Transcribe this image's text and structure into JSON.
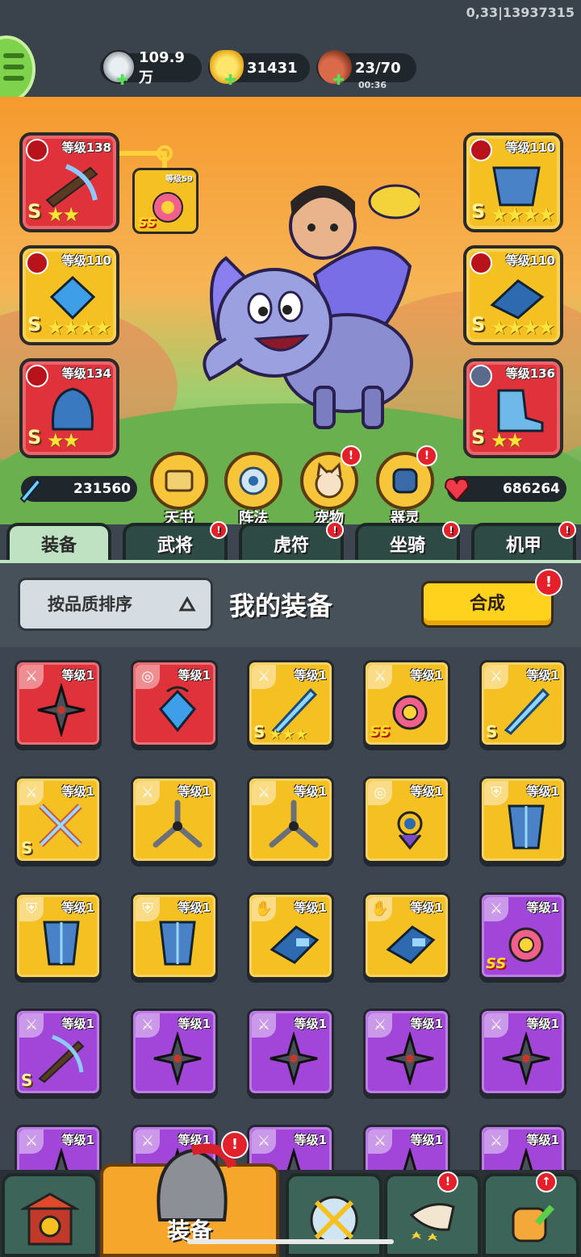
{
  "build_info": "0,33|13937315",
  "resources": {
    "silver": {
      "value": "109.9万",
      "icon": "silver-coin-icon"
    },
    "gold": {
      "value": "31431",
      "icon": "gold-ingot-icon"
    },
    "stamina": {
      "value": "23/70",
      "timer": "00:36",
      "icon": "meat-leg-icon"
    }
  },
  "hero": {
    "equipped_left": [
      {
        "level": "等级138",
        "grade": "S",
        "stars": "★★",
        "color": "red"
      },
      {
        "level": "等级110",
        "grade": "S",
        "stars": "★★★★",
        "color": "gold"
      },
      {
        "level": "等级134",
        "grade": "S",
        "stars": "★★",
        "color": "red"
      }
    ],
    "equipped_right": [
      {
        "level": "等级110",
        "grade": "S",
        "stars": "★★★★",
        "color": "gold"
      },
      {
        "level": "等级110",
        "grade": "S",
        "stars": "★★★★",
        "color": "gold"
      },
      {
        "level": "等级136",
        "grade": "S",
        "stars": "★★",
        "color": "red"
      }
    ],
    "linked_item": {
      "level": "等级59",
      "grade": "SS"
    },
    "attack": "231560",
    "hp": "686264"
  },
  "features": [
    {
      "label": "天书",
      "icon": "scroll-book-icon",
      "badge": false
    },
    {
      "label": "阵法",
      "icon": "formation-icon",
      "badge": false
    },
    {
      "label": "宠物",
      "icon": "pet-cat-icon",
      "badge": true
    },
    {
      "label": "器灵",
      "icon": "artifact-spirit-icon",
      "badge": true
    }
  ],
  "tabs": [
    {
      "label": "装备",
      "active": true,
      "badge": false
    },
    {
      "label": "武将",
      "active": false,
      "badge": true
    },
    {
      "label": "虎符",
      "active": false,
      "badge": true
    },
    {
      "label": "坐骑",
      "active": false,
      "badge": true
    },
    {
      "label": "机甲",
      "active": false,
      "badge": true
    }
  ],
  "panel": {
    "sort_label": "按品质排序",
    "title": "我的装备",
    "merge_label": "合成",
    "badge": "!"
  },
  "inventory": [
    {
      "level": "等级1",
      "color": "red",
      "tag": "sword",
      "art": "shuriken"
    },
    {
      "level": "等级1",
      "color": "red",
      "tag": "medal",
      "art": "amulet"
    },
    {
      "level": "等级1",
      "color": "gold",
      "tag": "sword",
      "art": "ice-blade",
      "grade": "S",
      "stars": "★★★"
    },
    {
      "level": "等级1",
      "color": "gold",
      "tag": "sword",
      "art": "feather-crown",
      "grade": "SS"
    },
    {
      "level": "等级1",
      "color": "gold",
      "tag": "sword",
      "art": "ice-blade",
      "grade": "S"
    },
    {
      "level": "等级1",
      "color": "gold",
      "tag": "sword",
      "art": "twin-swords",
      "grade": "S"
    },
    {
      "level": "等级1",
      "color": "gold",
      "tag": "sword",
      "art": "tri-blade"
    },
    {
      "level": "等级1",
      "color": "gold",
      "tag": "sword",
      "art": "tri-blade"
    },
    {
      "level": "等级1",
      "color": "gold",
      "tag": "medal",
      "art": "gem-amulet"
    },
    {
      "level": "等级1",
      "color": "gold",
      "tag": "armor",
      "art": "armor"
    },
    {
      "level": "等级1",
      "color": "gold",
      "tag": "armor",
      "art": "armor"
    },
    {
      "level": "等级1",
      "color": "gold",
      "tag": "armor",
      "art": "armor"
    },
    {
      "level": "等级1",
      "color": "gold",
      "tag": "gauntlet",
      "art": "gauntlet"
    },
    {
      "level": "等级1",
      "color": "gold",
      "tag": "gauntlet",
      "art": "gauntlet"
    },
    {
      "level": "等级1",
      "color": "purple",
      "tag": "sword",
      "art": "feather-crown",
      "grade": "SS"
    },
    {
      "level": "等级1",
      "color": "purple",
      "tag": "sword",
      "art": "crossbow",
      "grade": "S"
    },
    {
      "level": "等级1",
      "color": "purple",
      "tag": "sword",
      "art": "shuriken"
    },
    {
      "level": "等级1",
      "color": "purple",
      "tag": "sword",
      "art": "shuriken"
    },
    {
      "level": "等级1",
      "color": "purple",
      "tag": "sword",
      "art": "shuriken"
    },
    {
      "level": "等级1",
      "color": "purple",
      "tag": "sword",
      "art": "shuriken"
    },
    {
      "level": "等级1",
      "color": "purple",
      "tag": "sword",
      "art": "shuriken"
    },
    {
      "level": "等级1",
      "color": "purple",
      "tag": "sword",
      "art": "shuriken"
    },
    {
      "level": "等级1",
      "color": "purple",
      "tag": "sword",
      "art": "shuriken"
    },
    {
      "level": "等级1",
      "color": "purple",
      "tag": "sword",
      "art": "shuriken"
    },
    {
      "level": "等级1",
      "color": "purple",
      "tag": "sword",
      "art": "shuriken"
    }
  ],
  "bottom_nav": [
    {
      "label": "",
      "icon": "fortress-gate-icon"
    },
    {
      "label": "装备",
      "icon": "helmet-icon",
      "active": true
    },
    {
      "label": "",
      "icon": "crossed-swords-icon"
    },
    {
      "label": "",
      "icon": "horn-stars-icon"
    },
    {
      "label": "",
      "icon": "fist-upgrade-icon"
    }
  ],
  "colors": {
    "red": "#e0323a",
    "gold": "#f5c021",
    "purple": "#a146d8",
    "badge": "#e4202a",
    "accent": "#bfe3c2"
  }
}
